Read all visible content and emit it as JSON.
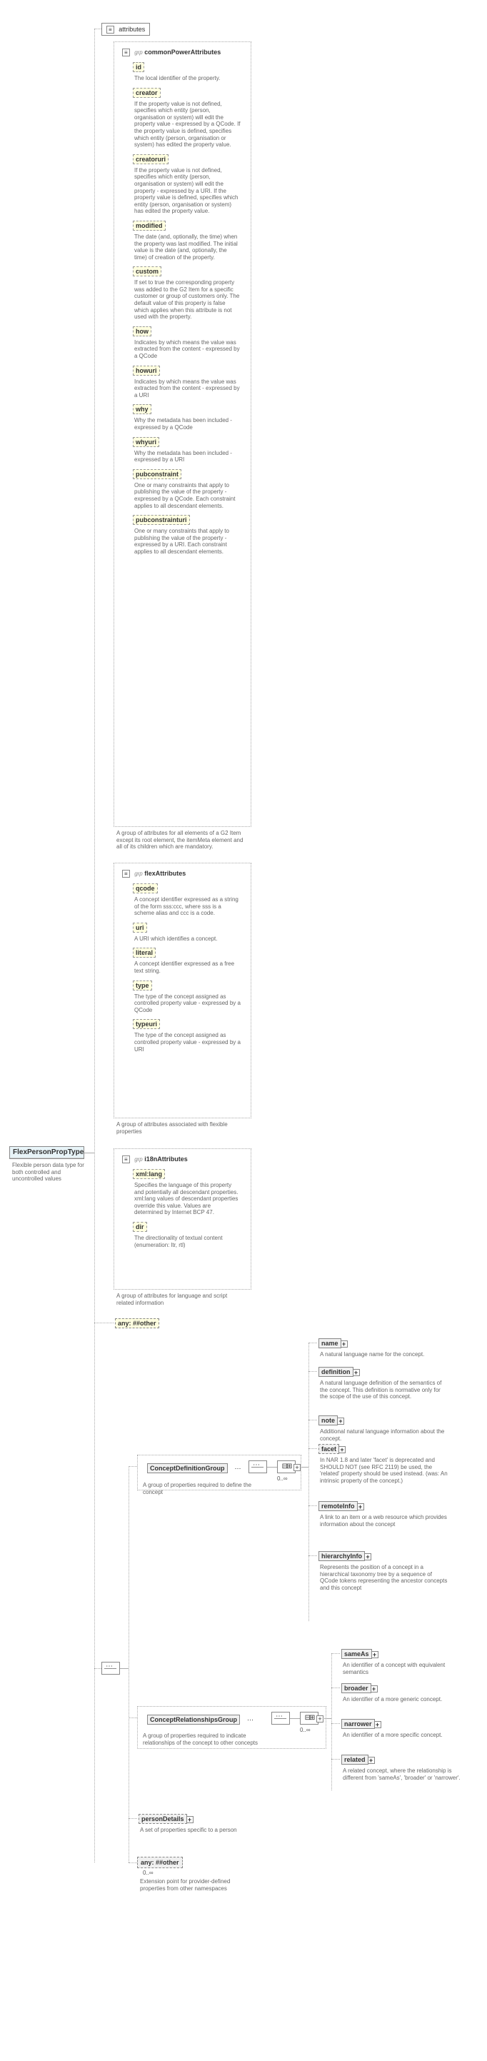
{
  "root": {
    "name": "FlexPersonPropType",
    "desc": "Flexible person data type for both controlled and uncontrolled values"
  },
  "attributesLabel": "attributes",
  "grpLabel": "grp",
  "commonPower": {
    "title": "commonPowerAttributes",
    "items": [
      {
        "name": "id",
        "desc": "The local identifier of the property.",
        "dashed": true
      },
      {
        "name": "creator",
        "desc": "If the property value is not defined, specifies which entity (person, organisation or system) will edit the property value - expressed by a QCode. If the property value is defined, specifies which entity (person, organisation or system) has edited the property value.",
        "dashed": true
      },
      {
        "name": "creatoruri",
        "desc": "If the property value is not defined, specifies which entity (person, organisation or system) will edit the property - expressed by a URI. If the property value is defined, specifies which entity (person, organisation or system) has edited the property value.",
        "dashed": true
      },
      {
        "name": "modified",
        "desc": "The date (and, optionally, the time) when the property was last modified. The initial value is the date (and, optionally, the time) of creation of the property.",
        "dashed": true
      },
      {
        "name": "custom",
        "desc": "If set to true the corresponding property was added to the G2 Item for a specific customer or group of customers only. The default value of this property is false which applies when this attribute is not used with the property.",
        "dashed": true
      },
      {
        "name": "how",
        "desc": "Indicates by which means the value was extracted from the content - expressed by a QCode",
        "dashed": true
      },
      {
        "name": "howuri",
        "desc": "Indicates by which means the value was extracted from the content - expressed by a URI",
        "dashed": true
      },
      {
        "name": "why",
        "desc": "Why the metadata has been included - expressed by a QCode",
        "dashed": true
      },
      {
        "name": "whyuri",
        "desc": "Why the metadata has been included - expressed by a URI",
        "dashed": true
      },
      {
        "name": "pubconstraint",
        "desc": "One or many constraints that apply to publishing the value of the property - expressed by a QCode. Each constraint applies to all descendant elements.",
        "dashed": true
      },
      {
        "name": "pubconstrainturi",
        "desc": "One or many constraints that apply to publishing the value of the property - expressed by a URI. Each constraint applies to all descendant elements.",
        "dashed": true
      }
    ],
    "footer": "A group of attributes for all elements of a G2 Item except its root element, the itemMeta element and all of its children which are mandatory."
  },
  "flexAttr": {
    "title": "flexAttributes",
    "items": [
      {
        "name": "qcode",
        "desc": "A concept identifier expressed as a string of the form sss:ccc, where sss is a scheme alias and ccc is a code.",
        "dashed": true
      },
      {
        "name": "uri",
        "desc": "A URI which identifies a concept.",
        "dashed": true
      },
      {
        "name": "literal",
        "desc": "A concept identifier expressed as a free text string.",
        "dashed": true
      },
      {
        "name": "type",
        "desc": "The type of the concept assigned as controlled property value - expressed by a QCode",
        "dashed": true
      },
      {
        "name": "typeuri",
        "desc": "The type of the concept assigned as controlled property value - expressed by a URI",
        "dashed": true
      }
    ],
    "footer": "A group of attributes associated with flexible properties"
  },
  "i18n": {
    "title": "i18nAttributes",
    "items": [
      {
        "name": "xml:lang",
        "desc": "Specifies the language of this property and potentially all descendant properties. xml:lang values of descendant properties override this value. Values are determined by Internet BCP 47.",
        "dashed": true
      },
      {
        "name": "dir",
        "desc": "The directionality of textual content (enumeration: ltr, rtl)",
        "dashed": true
      }
    ],
    "footer": "A group of attributes for language and script related information"
  },
  "anyOther": "##other",
  "anyLabel": "any:",
  "conceptDef": {
    "title": "ConceptDefinitionGroup",
    "desc": "A group of properties required to define the concept",
    "items": [
      {
        "name": "name",
        "desc": "A natural language name for the concept."
      },
      {
        "name": "definition",
        "desc": "A natural language definition of the semantics of the concept. This definition is normative only for the scope of the use of this concept."
      },
      {
        "name": "note",
        "desc": "Additional natural language information about the concept."
      },
      {
        "name": "facet",
        "desc": "In NAR 1.8 and later 'facet' is deprecated and SHOULD NOT (see RFC 2119) be used, the 'related' property should be used instead. (was: An intrinsic property of the concept.)"
      },
      {
        "name": "remoteInfo",
        "desc": "A link to an item or a web resource which provides information about the concept"
      },
      {
        "name": "hierarchyInfo",
        "desc": "Represents the position of a concept in a hierarchical taxonomy tree by a sequence of QCode tokens representing the ancestor concepts and this concept"
      }
    ]
  },
  "conceptRel": {
    "title": "ConceptRelationshipsGroup",
    "desc": "A group of properties required to indicate relationships of the concept to other concepts",
    "items": [
      {
        "name": "sameAs",
        "desc": "An identifier of a concept with equivalent semantics"
      },
      {
        "name": "broader",
        "desc": "An identifier of a more generic concept."
      },
      {
        "name": "narrower",
        "desc": "An identifier of a more specific concept."
      },
      {
        "name": "related",
        "desc": "A related concept, where the relationship is different from 'sameAs', 'broader' or 'narrower'."
      }
    ]
  },
  "personDetails": {
    "name": "personDetails",
    "desc": "A set of properties specific to a person"
  },
  "anyExt": {
    "desc": "Extension point for provider-defined properties from other namespaces",
    "card": "0..∞"
  },
  "cardInf": "0..∞"
}
